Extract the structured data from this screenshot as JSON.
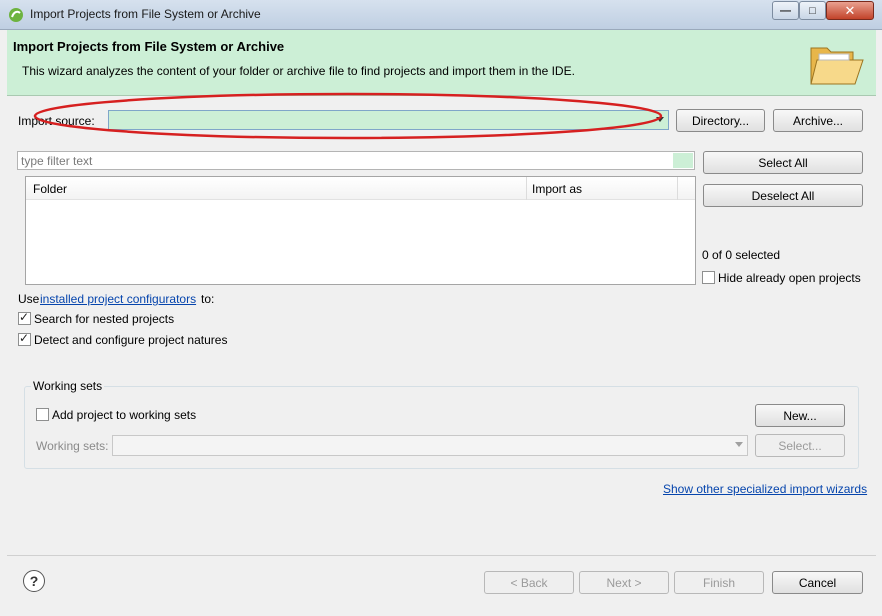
{
  "window": {
    "title": "Import Projects from File System or Archive",
    "controls": [
      "minimize-icon",
      "maximize-icon",
      "close-icon"
    ]
  },
  "header": {
    "title": "Import Projects from File System or Archive",
    "description": "This wizard analyzes the content of your folder or archive file to find projects and import them in the IDE."
  },
  "import_source": {
    "label": "Import source:",
    "value": "",
    "directory_button": "Directory...",
    "archive_button": "Archive..."
  },
  "filter": {
    "placeholder": "type filter text"
  },
  "table": {
    "columns": [
      "Folder",
      "Import as"
    ],
    "rows": []
  },
  "selection": {
    "select_all": "Select All",
    "deselect_all": "Deselect All",
    "count_text": "0 of 0 selected",
    "hide_open_label": "Hide already open projects",
    "hide_open_checked": false
  },
  "configurators": {
    "prefix": "Use",
    "link_text": "installed project configurators",
    "suffix": "to:"
  },
  "options": [
    {
      "label": "Search for nested projects",
      "checked": true
    },
    {
      "label": "Detect and configure project natures",
      "checked": true
    }
  ],
  "working_sets": {
    "group_title": "Working sets",
    "add_label": "Add project to working sets",
    "add_checked": false,
    "new_button": "New...",
    "sets_label": "Working sets:",
    "select_button": "Select..."
  },
  "show_other_link": "Show other specialized import wizards",
  "footer": {
    "help_symbol": "?",
    "back": "< Back",
    "next": "Next >",
    "finish": "Finish",
    "cancel": "Cancel"
  },
  "colors": {
    "header_bg": "#ccefd6",
    "link": "#0645ad",
    "annotation": "#d62020"
  }
}
